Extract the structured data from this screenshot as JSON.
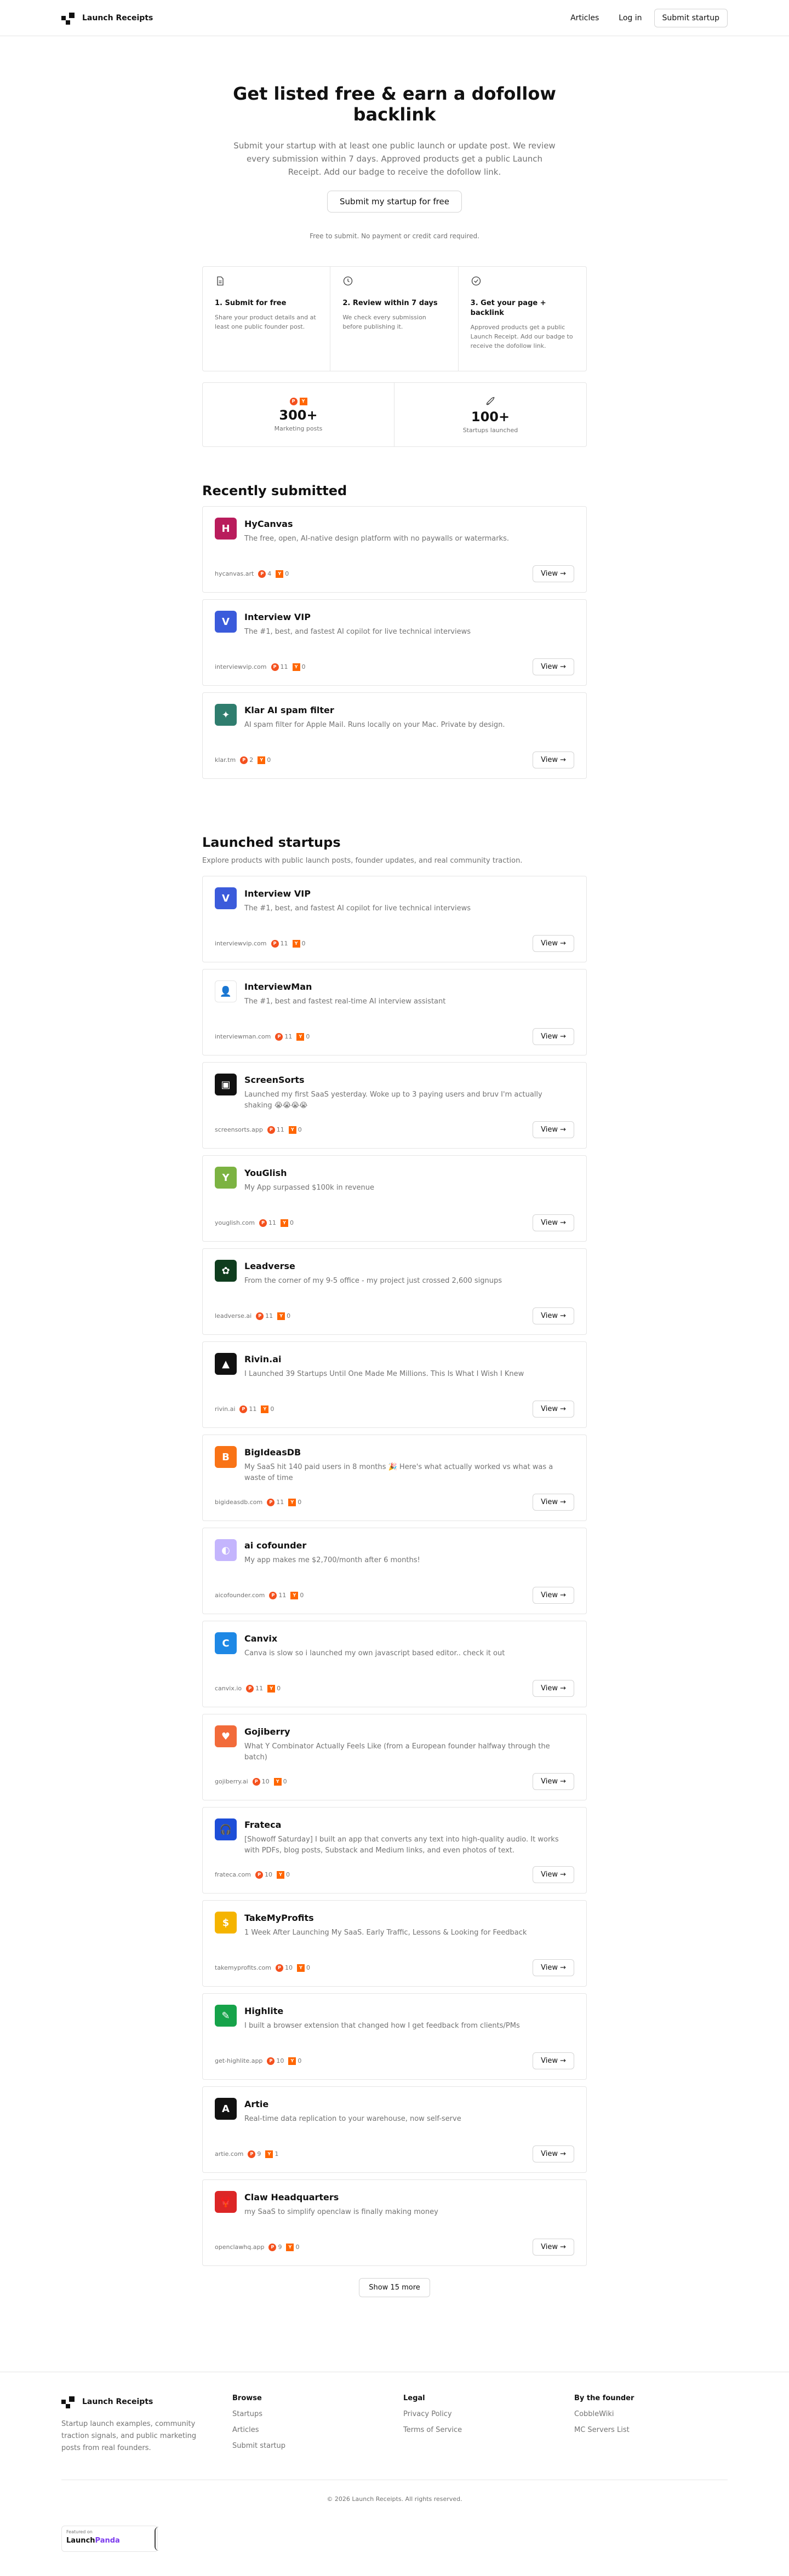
{
  "nav": {
    "brand": "Launch Receipts",
    "links": [
      "Articles",
      "Log in"
    ],
    "cta": "Submit startup"
  },
  "hero": {
    "title": "Get listed free & earn a dofollow backlink",
    "subtitle": "Submit your startup with at least one public launch or update post. We review every submission within 7 days. Approved products get a public Launch Receipt. Add our badge to receive the dofollow link.",
    "button": "Submit my startup for free",
    "note": "Free to submit. No payment or credit card required."
  },
  "steps": [
    {
      "icon": "document-icon",
      "title": "1. Submit for free",
      "text": "Share your product details and at least one public founder post."
    },
    {
      "icon": "clock-icon",
      "title": "2. Review within 7 days",
      "text": "We check every submission before publishing it."
    },
    {
      "icon": "check-circle-icon",
      "title": "3. Get your page + backlink",
      "text": "Approved products get a public Launch Receipt. Add our badge to receive the dofollow link."
    }
  ],
  "stats": [
    {
      "value": "300+",
      "label": "Marketing posts",
      "icon": "ph-hn-badges"
    },
    {
      "value": "100+",
      "label": "Startups launched",
      "icon": "rocket-icon"
    }
  ],
  "recent": {
    "title": "Recently submitted",
    "items": [
      {
        "name": "HyCanvas",
        "tagline": "The free, open, AI-native design platform with no paywalls or watermarks.",
        "domain": "hycanvas.art",
        "ph": "4",
        "hn": "0",
        "color": "#b91c5c",
        "glyph": "H"
      },
      {
        "name": "Interview VIP",
        "tagline": "The #1, best, and fastest AI copilot for live technical interviews",
        "domain": "interviewvip.com",
        "ph": "11",
        "hn": "0",
        "color": "#3b5bdb",
        "glyph": "V"
      },
      {
        "name": "Klar AI spam filter",
        "tagline": "AI spam filter for Apple Mail. Runs locally on your Mac. Private by design.",
        "domain": "klar.tm",
        "ph": "2",
        "hn": "0",
        "color": "#2f7d6e",
        "glyph": "✦"
      }
    ]
  },
  "launched": {
    "title": "Launched startups",
    "description": "Explore products with public launch posts, founder updates, and real community traction.",
    "items": [
      {
        "name": "Interview VIP",
        "tagline": "The #1, best, and fastest AI copilot for live technical interviews",
        "domain": "interviewvip.com",
        "ph": "11",
        "hn": "0",
        "color": "#3b5bdb",
        "glyph": "V"
      },
      {
        "name": "InterviewMan",
        "tagline": "The #1, best and fastest real-time AI interview assistant",
        "domain": "interviewman.com",
        "ph": "11",
        "hn": "0",
        "color": "#ffffff",
        "glyph": "👤"
      },
      {
        "name": "ScreenSorts",
        "tagline": "Launched my first SaaS yesterday. Woke up to 3 paying users and bruv I'm actually shaking 😭😭😭😭",
        "domain": "screensorts.app",
        "ph": "11",
        "hn": "0",
        "color": "#111111",
        "glyph": "▣"
      },
      {
        "name": "YouGlish",
        "tagline": "My App surpassed $100k in revenue",
        "domain": "youglish.com",
        "ph": "11",
        "hn": "0",
        "color": "#7cb342",
        "glyph": "Y"
      },
      {
        "name": "Leadverse",
        "tagline": "From the corner of my 9-5 office - my project just crossed 2,600 signups",
        "domain": "leadverse.ai",
        "ph": "11",
        "hn": "0",
        "color": "#0f3d1e",
        "glyph": "✿"
      },
      {
        "name": "Rivin.ai",
        "tagline": "I Launched 39 Startups Until One Made Me Millions. This Is What I Wish I Knew",
        "domain": "rivin.ai",
        "ph": "11",
        "hn": "0",
        "color": "#111111",
        "glyph": "▲"
      },
      {
        "name": "BigIdeasDB",
        "tagline": "My SaaS hit 140 paid users in 8 months 🎉 Here's what actually worked vs what was a waste of time",
        "domain": "bigideasdb.com",
        "ph": "11",
        "hn": "0",
        "color": "#f97316",
        "glyph": "B"
      },
      {
        "name": "ai cofounder",
        "tagline": "My app makes me $2,700/month after 6 months!",
        "domain": "aicofounder.com",
        "ph": "11",
        "hn": "0",
        "color": "#c4b5fd",
        "glyph": "◐"
      },
      {
        "name": "Canvix",
        "tagline": "Canva is slow so i launched my own javascript based editor.. check it out",
        "domain": "canvix.io",
        "ph": "11",
        "hn": "0",
        "color": "#1e88e5",
        "glyph": "C"
      },
      {
        "name": "Gojiberry",
        "tagline": "What Y Combinator Actually Feels Like (from a European founder halfway through the batch)",
        "domain": "gojiberry.ai",
        "ph": "10",
        "hn": "0",
        "color": "#f26b3a",
        "glyph": "♥"
      },
      {
        "name": "Frateca",
        "tagline": "[Showoff Saturday] I built an app that converts any text into high-quality audio. It works with PDFs, blog posts, Substack and Medium links, and even photos of text.",
        "domain": "frateca.com",
        "ph": "10",
        "hn": "0",
        "color": "#1d4ed8",
        "glyph": "🎧"
      },
      {
        "name": "TakeMyProfits",
        "tagline": "1 Week After Launching My SaaS. Early Traffic, Lessons & Looking for Feedback",
        "domain": "takemyprofits.com",
        "ph": "10",
        "hn": "0",
        "color": "#f5b400",
        "glyph": "$"
      },
      {
        "name": "Highlite",
        "tagline": "I built a browser extension that changed how I get feedback from clients/PMs",
        "domain": "get-highlite.app",
        "ph": "10",
        "hn": "0",
        "color": "#16a34a",
        "glyph": "✎"
      },
      {
        "name": "Artie",
        "tagline": "Real-time data replication to your warehouse, now self-serve",
        "domain": "artie.com",
        "ph": "9",
        "hn": "1",
        "color": "#111111",
        "glyph": "A"
      },
      {
        "name": "Claw Headquarters",
        "tagline": "my SaaS to simplify openclaw is finally making money",
        "domain": "openclawhq.app",
        "ph": "9",
        "hn": "0",
        "color": "#dc2626",
        "glyph": "🦞"
      }
    ],
    "show_more": "Show 15 more"
  },
  "view_label": "View →",
  "footer": {
    "brand": "Launch Receipts",
    "about": "Startup launch examples, community traction signals, and public marketing posts from real founders.",
    "browse": {
      "title": "Browse",
      "links": [
        "Startups",
        "Articles",
        "Submit startup"
      ]
    },
    "legal": {
      "title": "Legal",
      "links": [
        "Privacy Policy",
        "Terms of Service"
      ]
    },
    "founder": {
      "title": "By the founder",
      "links": [
        "CobbleWiki",
        "MC Servers List"
      ]
    },
    "copyright": "© 2026 Launch Receipts. All rights reserved.",
    "featured_small": "Featured on",
    "featured_brand_a": "Launch",
    "featured_brand_b": "Panda"
  }
}
